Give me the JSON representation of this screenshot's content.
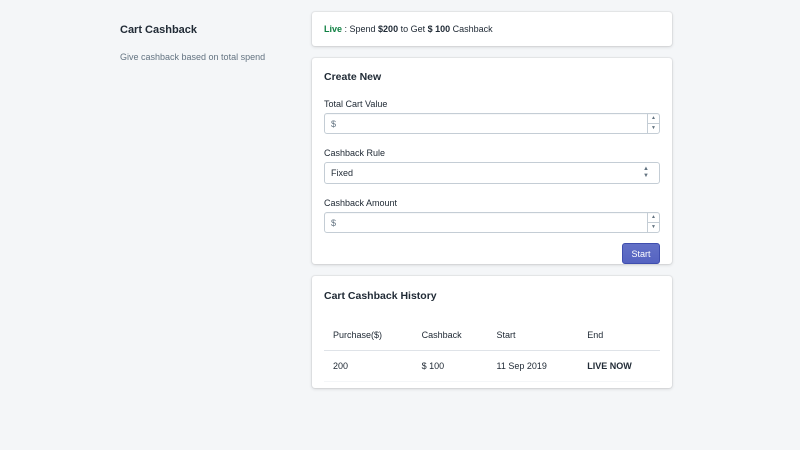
{
  "section": {
    "title": "Cart Cashback",
    "description": "Give cashback based on total spend"
  },
  "status": {
    "live_label": "Live",
    "separator": " : Spend ",
    "spend_amount": "$200",
    "middle": " to Get ",
    "cashback_amount": "$ 100",
    "suffix": " Cashback"
  },
  "create": {
    "title": "Create New",
    "total_cart_value": {
      "label": "Total Cart Value",
      "placeholder": "$",
      "value": ""
    },
    "cashback_rule": {
      "label": "Cashback Rule",
      "value": "Fixed"
    },
    "cashback_amount": {
      "label": "Cashback Amount",
      "placeholder": "$",
      "value": ""
    },
    "start_label": "Start"
  },
  "history": {
    "title": "Cart Cashback History",
    "columns": [
      "Purchase($)",
      "Cashback",
      "Start",
      "End"
    ],
    "rows": [
      {
        "purchase": "200",
        "cashback": "$ 100",
        "start": "11 Sep 2019",
        "end": "LIVE NOW"
      }
    ]
  },
  "colors": {
    "background": "#f4f6f8",
    "accent": "#5c6ac4",
    "live_green": "#108043"
  },
  "icons": {
    "spinner_up": "triangle-up-icon",
    "spinner_down": "triangle-down-icon",
    "select_caret": "select-caret-icon"
  }
}
